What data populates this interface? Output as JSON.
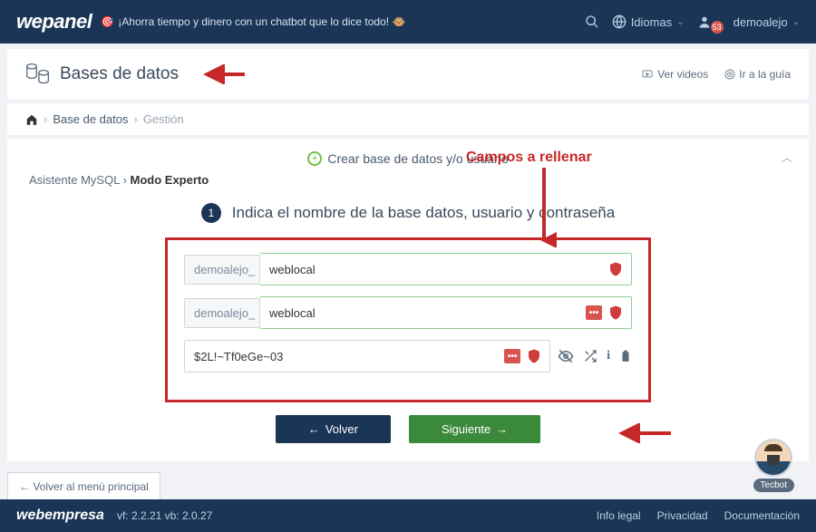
{
  "topbar": {
    "logo": "wepanel",
    "promo": "¡Ahorra tiempo y dinero con un chatbot que lo dice todo! 🐵",
    "idiomas": "Idiomas",
    "user": "demoalejo",
    "notif_count": "53"
  },
  "header": {
    "title": "Bases de datos",
    "videos": "Ver videos",
    "guide": "Ir a la guía"
  },
  "breadcrumb": {
    "c1": "Base de datos",
    "c2": "Gestión"
  },
  "panel": {
    "create_label": "Crear base de datos y/o usuario",
    "annot": "Campos a rellenar",
    "sub_a": "Asistente MySQL ",
    "sub_b": "Modo Experto",
    "step_num": "1",
    "step_text": "Indica el nombre de la base datos, usuario y contraseña",
    "prefix": "demoalejo_",
    "db_value": "weblocal",
    "user_value": "weblocal",
    "pw_value": "$2L!~Tf0eGe~03",
    "btn_back": "Volver",
    "btn_next": "Siguiente",
    "back_main": "Volver al menú principal"
  },
  "chatbot": {
    "label": "Tecbot"
  },
  "footer": {
    "logo": "webempresa",
    "version": "vf: 2.2.21 vb: 2.0.27",
    "l1": "Info legal",
    "l2": "Privacidad",
    "l3": "Documentación"
  }
}
